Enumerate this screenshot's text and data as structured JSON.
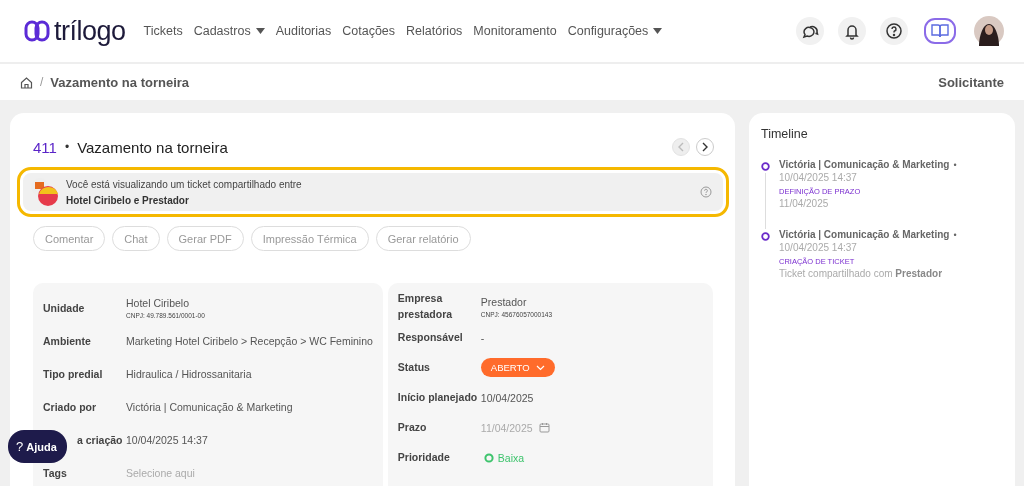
{
  "header": {
    "logo": "trílogo",
    "nav": [
      {
        "label": "Tickets",
        "has_menu": false
      },
      {
        "label": "Cadastros",
        "has_menu": true
      },
      {
        "label": "Auditorias",
        "has_menu": false
      },
      {
        "label": "Cotações",
        "has_menu": false
      },
      {
        "label": "Relatórios",
        "has_menu": false
      },
      {
        "label": "Monitoramento",
        "has_menu": false
      },
      {
        "label": "Configurações",
        "has_menu": true
      }
    ]
  },
  "breadcrumb": {
    "separator": "/",
    "current": "Vazamento na torneira",
    "role": "Solicitante"
  },
  "ticket": {
    "number": "411",
    "separator": "•",
    "title": "Vazamento na torneira",
    "shared_notice": {
      "text": "Você está visualizando um ticket compartilhado entre",
      "parties": "Hotel Ciribelo e Prestador"
    },
    "actions": [
      "Comentar",
      "Chat",
      "Gerar PDF",
      "Impressão Térmica",
      "Gerar relatório"
    ],
    "left_fields": [
      {
        "kind": "text",
        "label": "Unidade",
        "value": "Hotel Ciribelo",
        "sub": "CNPJ: 49.789.561/0001-00"
      },
      {
        "kind": "text",
        "label": "Ambiente",
        "value": "Marketing Hotel Ciribelo > Recepção > WC Feminino"
      },
      {
        "kind": "text",
        "label": "Tipo predial",
        "value": "Hidraulica / Hidrossanitaria"
      },
      {
        "kind": "text",
        "label": "Criado por",
        "value": "Victória | Comunicação & Marketing"
      },
      {
        "kind": "text",
        "label": "a criação",
        "value": "10/04/2025 14:37"
      },
      {
        "kind": "placeholder",
        "label": "Tags",
        "placeholder": "Selecione aqui"
      }
    ],
    "right_fields": [
      {
        "kind": "text",
        "label": "Empresa prestadora",
        "value": "Prestador",
        "sub": "CNPJ: 45676057000143"
      },
      {
        "kind": "text",
        "label": "Responsável",
        "value": "-"
      },
      {
        "kind": "status",
        "label": "Status",
        "value": "ABERTO",
        "color": "#ff6b2b"
      },
      {
        "kind": "text",
        "label": "Início planejado",
        "value": "10/04/2025"
      },
      {
        "kind": "date",
        "label": "Prazo",
        "value": "11/04/2025",
        "disabled": true
      },
      {
        "kind": "priority",
        "label": "Prioridade",
        "value": "Baixa",
        "color": "#3ec46d"
      }
    ]
  },
  "timeline": {
    "title": "Timeline",
    "entries": [
      {
        "author": "Victória | Comunicação & Marketing",
        "separator": "•",
        "time": "10/04/2025 14:37",
        "action": "DEFINIÇÃO DE PRAZO",
        "detail": "11/04/2025"
      },
      {
        "author": "Victória | Comunicação & Marketing",
        "separator": "•",
        "time": "10/04/2025 14:37",
        "action": "CRIAÇÃO DE TICKET",
        "detail": "Ticket compartilhado com **Prestador**"
      }
    ]
  },
  "help_button": {
    "icon": "?",
    "label": "Ajuda"
  }
}
